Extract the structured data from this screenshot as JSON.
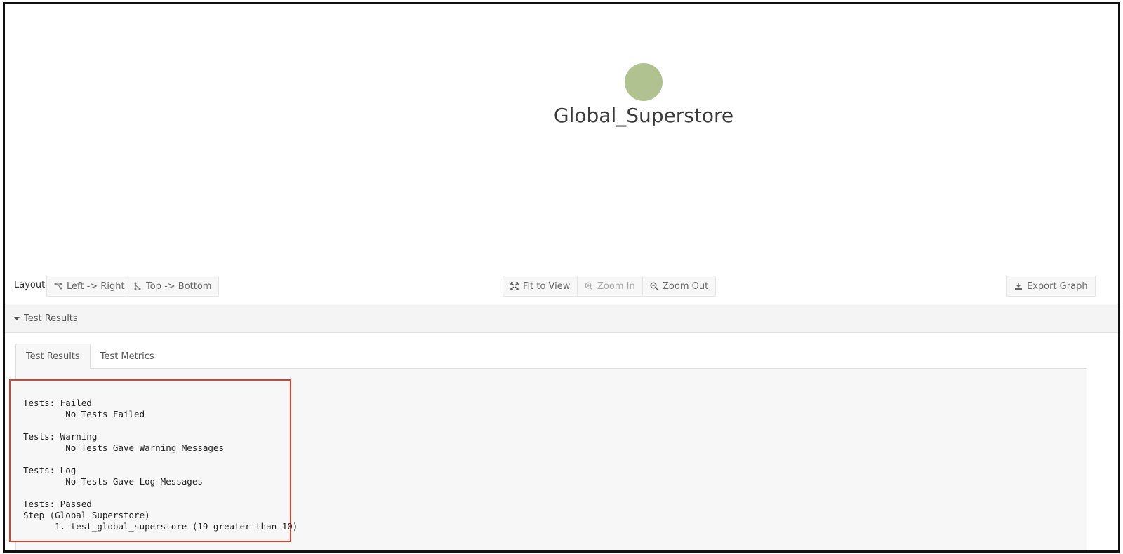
{
  "graph": {
    "node_label": "Global_Superstore",
    "node_color": "#b0c28f"
  },
  "toolbar": {
    "layout_label": "Layout:",
    "left_right": "Left -> Right",
    "top_bottom": "Top -> Bottom",
    "fit_to_view": "Fit to View",
    "zoom_in": "Zoom In",
    "zoom_out": "Zoom Out",
    "export_graph": "Export Graph"
  },
  "accordion": {
    "title": "Test Results"
  },
  "tabs": [
    {
      "label": "Test Results",
      "active": true
    },
    {
      "label": "Test Metrics",
      "active": false
    }
  ],
  "results": {
    "failed_heading": "Tests: Failed",
    "failed_msg": "        No Tests Failed",
    "warning_heading": "Tests: Warning",
    "warning_msg": "        No Tests Gave Warning Messages",
    "log_heading": "Tests: Log",
    "log_msg": "        No Tests Gave Log Messages",
    "passed_heading": "Tests: Passed",
    "step_line": "Step (Global_Superstore)",
    "passed_item": "      1. test_global_superstore (19 greater-than 10)"
  },
  "colors": {
    "highlight": "#e0402a"
  }
}
